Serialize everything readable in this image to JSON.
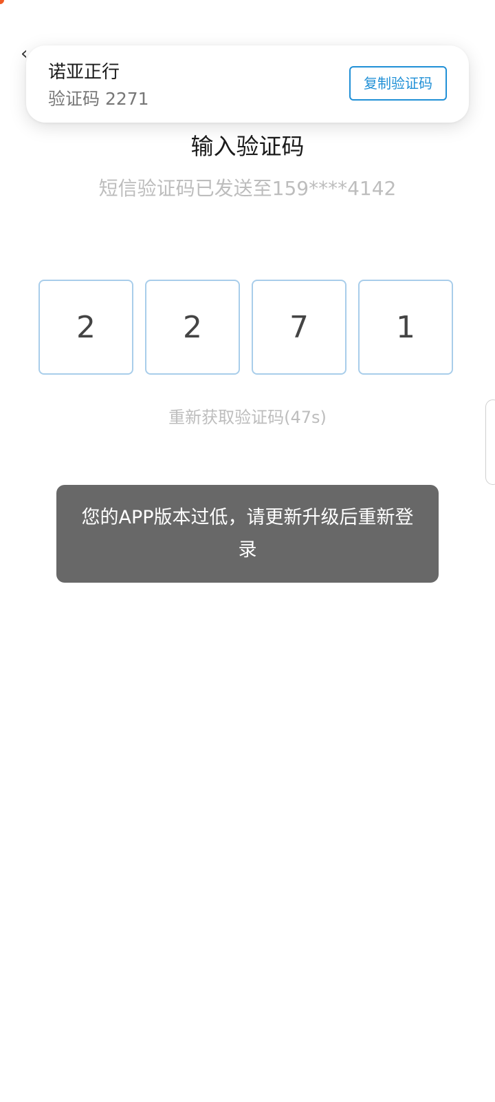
{
  "notification": {
    "sender": "诺亚正行",
    "message": "验证码 2271",
    "copy_button": "复制验证码"
  },
  "title": "输入验证码",
  "subtitle": "短信验证码已发送至159****4142",
  "code_digits": [
    "2",
    "2",
    "7",
    "1"
  ],
  "resend_label": "重新获取验证码(47s)",
  "toast_message": "您的APP版本过低，请更新升级后重新登录",
  "colors": {
    "accent": "#1f8fd6",
    "box_border": "#a8cdea",
    "toast_bg": "#686868",
    "muted_text": "#bdbdbd"
  }
}
